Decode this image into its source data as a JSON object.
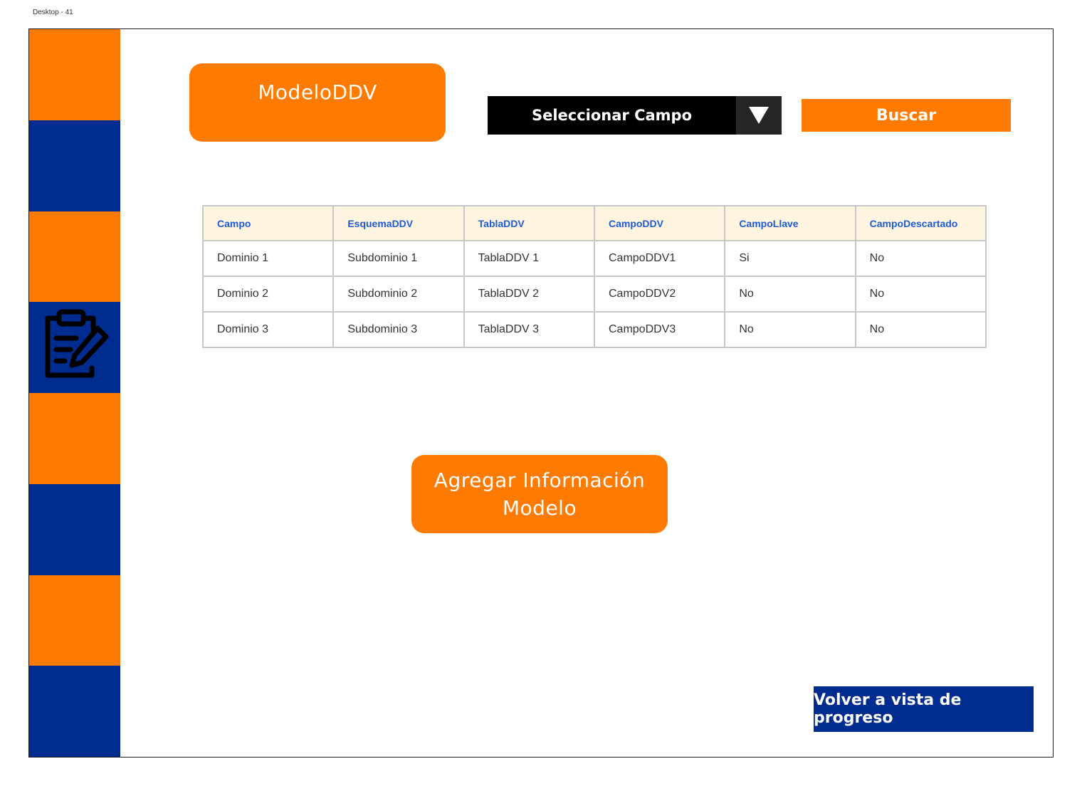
{
  "frame": {
    "label": "Desktop - 41"
  },
  "sidebar": {
    "icon": "clipboard-edit-icon",
    "colors": {
      "orange": "#fe7a00",
      "blue": "#002b8f"
    }
  },
  "header": {
    "title": "ModeloDDV",
    "select": {
      "label": "Seleccionar Campo",
      "arrow_icon": "triangle-down-icon"
    },
    "search_button": "Buscar"
  },
  "table": {
    "columns": [
      "Campo",
      "EsquemaDDV",
      "TablaDDV",
      "CampoDDV",
      "CampoLlave",
      "CampoDescartado"
    ],
    "rows": [
      [
        "Dominio 1",
        "Subdominio 1",
        "TablaDDV 1",
        "CampoDDV1",
        "Si",
        "No"
      ],
      [
        "Dominio 2",
        "Subdominio 2",
        "TablaDDV 2",
        "CampoDDV2",
        "No",
        "No"
      ],
      [
        "Dominio 3",
        "Subdominio 3",
        "TablaDDV 3",
        "CampoDDV3",
        "No",
        "No"
      ]
    ]
  },
  "actions": {
    "add_line1": "Agregar Información",
    "add_line2": "Modelo",
    "back_button": "Volver a vista de progreso"
  }
}
